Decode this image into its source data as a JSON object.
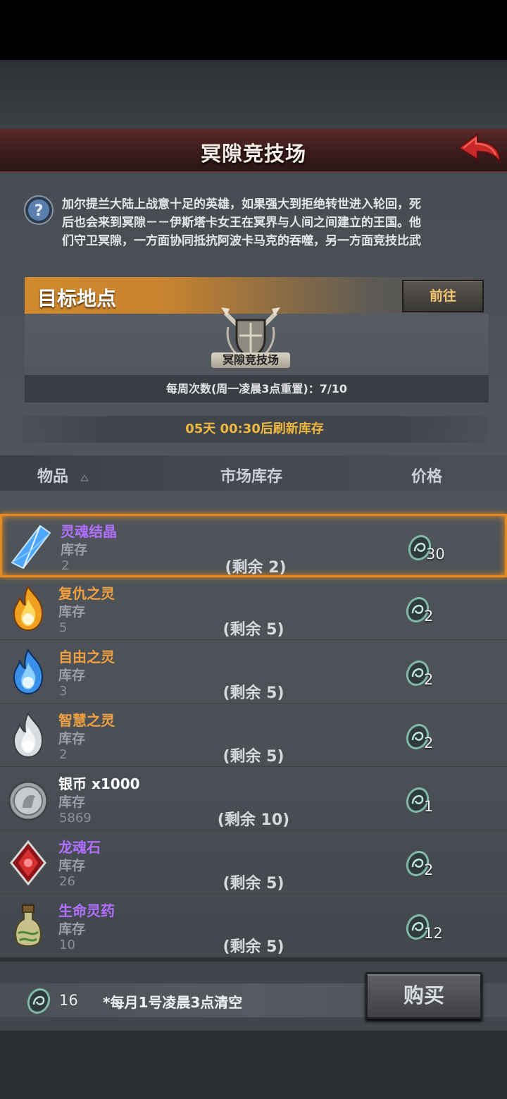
{
  "header": {
    "title": "冥隙竞技场"
  },
  "description": {
    "lines": [
      "加尔提兰大陆上战意十足的英雄，如果强大到拒绝转世进入轮回，死",
      "后也会来到冥隙－－伊斯塔卡女王在冥界与人间之间建立的王国。他",
      "们守卫冥隙，一方面协同抵抗阿波卡马克的吞噬，另一方面竞技比武"
    ]
  },
  "target": {
    "title": "目标地点",
    "go_label": "前往",
    "arena_label": "冥隙竞技场",
    "weekly": "每周次数(周一凌晨3点重置)：7/10"
  },
  "refresh": "05天 00:30后刷新库存",
  "table": {
    "headers": {
      "item": "物品",
      "stock": "市场库存",
      "price": "价格"
    }
  },
  "items": [
    {
      "name": "灵魂结晶",
      "name_color": "#b070ff",
      "stock_label": "库存",
      "stock": "2",
      "remain": "(剩余 2)",
      "price": "30",
      "icon": "crystal-icon",
      "selected": true
    },
    {
      "name": "复仇之灵",
      "name_color": "#f0a040",
      "stock_label": "库存",
      "stock": "5",
      "remain": "(剩余 5)",
      "price": "2",
      "icon": "fire-spirit-icon"
    },
    {
      "name": "自由之灵",
      "name_color": "#f0a040",
      "stock_label": "库存",
      "stock": "3",
      "remain": "(剩余 5)",
      "price": "2",
      "icon": "blue-spirit-icon"
    },
    {
      "name": "智慧之灵",
      "name_color": "#f0a040",
      "stock_label": "库存",
      "stock": "2",
      "remain": "(剩余 5)",
      "price": "2",
      "icon": "white-spirit-icon"
    },
    {
      "name": "银币 x1000",
      "name_color": "#ffffff",
      "stock_label": "库存",
      "stock": "5869",
      "remain": "(剩余 10)",
      "price": "1",
      "icon": "silver-coin-icon"
    },
    {
      "name": "龙魂石",
      "name_color": "#b070ff",
      "stock_label": "库存",
      "stock": "26",
      "remain": "(剩余 5)",
      "price": "2",
      "icon": "dragon-stone-icon"
    },
    {
      "name": "生命灵药",
      "name_color": "#b070ff",
      "stock_label": "库存",
      "stock": "10",
      "remain": "(剩余 5)",
      "price": "12",
      "icon": "potion-icon"
    }
  ],
  "footer": {
    "currency": "16",
    "note": "*每月1号凌晨3点清空",
    "buy_label": "购买"
  },
  "colors": {
    "accent": "#e68a22",
    "refresh": "#f0b840",
    "purple": "#b070ff",
    "orange": "#f0a040"
  }
}
